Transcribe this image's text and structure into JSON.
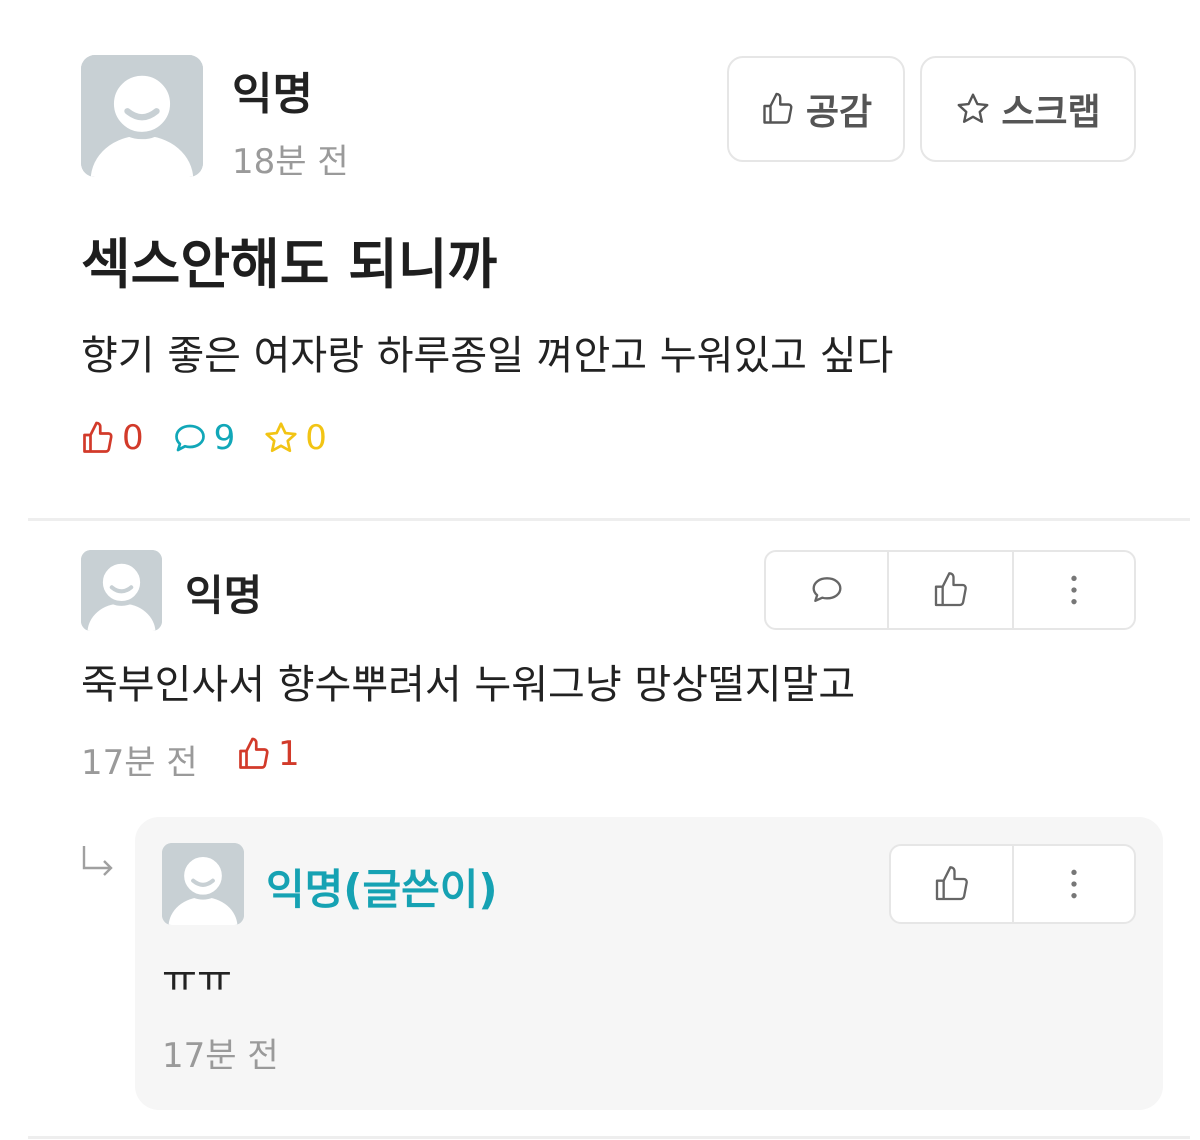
{
  "post": {
    "author": "익명",
    "time": "18분 전",
    "like_button": "공감",
    "scrap_button": "스크랩",
    "title": "섹스안해도 되니까",
    "body": "향기 좋은 여자랑 하루종일 껴안고 누워있고 싶다",
    "stats": {
      "likes": "0",
      "comments": "9",
      "scraps": "0"
    }
  },
  "comment": {
    "author": "익명",
    "text": "죽부인사서 향수뿌려서 누워그냥 망상떨지말고",
    "time": "17분 전",
    "likes": "1"
  },
  "reply": {
    "author": "익명(글쓴이)",
    "text": "ㅠㅠ",
    "time": "17분 전"
  },
  "colors": {
    "like_red": "#d23a2a",
    "comment_teal": "#11a7b8",
    "scrap_yellow": "#f2c414",
    "author_teal": "#16a2b3",
    "avatar_gray": "#c8d0d4"
  },
  "icons": [
    "thumbs-up-icon",
    "star-icon",
    "speech-bubble-icon",
    "more-vertical-icon",
    "reply-arrow-icon",
    "avatar-icon"
  ]
}
